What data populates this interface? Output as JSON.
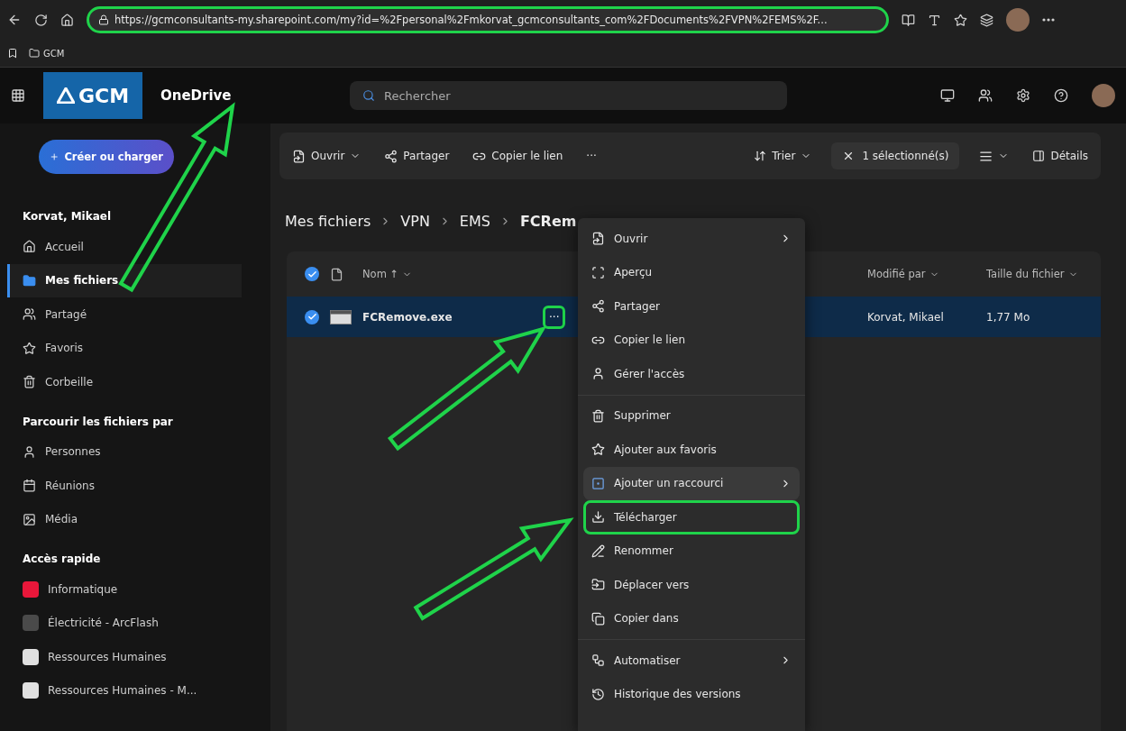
{
  "browser": {
    "url": "https://gcmconsultants-my.sharepoint.com/my?id=%2Fpersonal%2Fmkorvat_gcmconsultants_com%2FDocuments%2FVPN%2FEMS%2F...",
    "url_highlighted": true,
    "bookmarks": [
      "GCM"
    ]
  },
  "app": {
    "logo": "GCM",
    "title": "OneDrive",
    "search": {
      "placeholder": "Rechercher"
    }
  },
  "sidebar": {
    "create_button": "Créer ou charger",
    "sections": [
      {
        "heading": "Korvat, Mikael",
        "items": [
          {
            "label": "Accueil",
            "selected": false
          },
          {
            "label": "Mes fichiers",
            "selected": true
          },
          {
            "label": "Partagé",
            "selected": false
          },
          {
            "label": "Favoris",
            "selected": false
          },
          {
            "label": "Corbeille",
            "selected": false
          }
        ]
      },
      {
        "heading": "Parcourir les fichiers par",
        "items": [
          {
            "label": "Personnes",
            "selected": false
          },
          {
            "label": "Réunions",
            "selected": false
          },
          {
            "label": "Média",
            "selected": false
          }
        ]
      },
      {
        "heading": "Accès rapide",
        "items": [
          {
            "label": "Informatique",
            "color": "#e8173a",
            "selected": false
          },
          {
            "label": "Électricité - ArcFlash",
            "color": "#4a4a4a",
            "selected": false
          },
          {
            "label": "Ressources Humaines",
            "color": "#e0e0e0",
            "selected": false
          },
          {
            "label": "Ressources Humaines - M...",
            "color": "#e0e0e0",
            "selected": false
          }
        ]
      }
    ]
  },
  "toolbar": {
    "left": [
      {
        "label": "Ouvrir",
        "caret": true
      },
      {
        "label": "Partager",
        "caret": false
      },
      {
        "label": "Copier le lien",
        "caret": false
      },
      {
        "label": "···",
        "caret": false
      }
    ],
    "sort": "Trier",
    "selection": "1 sélectionné(s)",
    "details": "Détails"
  },
  "breadcrumb": [
    "Mes fichiers",
    "VPN",
    "EMS",
    "FCRem"
  ],
  "table": {
    "all_checked": true,
    "columns": [
      {
        "label": "Nom ↑",
        "sortable": true
      },
      {
        "label": "Modifié par",
        "sortable": true
      },
      {
        "label": "Taille du fichier",
        "sortable": true
      }
    ],
    "rows": [
      {
        "name": "FCRemove.exe",
        "selected": true,
        "more": "···",
        "more_highlighted": true,
        "modified_by": "Korvat, Mikael",
        "size": "1,77 Mo"
      }
    ]
  },
  "context_menu": {
    "groups": [
      [
        {
          "label": "Ouvrir",
          "submenu": true,
          "selected": false,
          "highlighted": false
        },
        {
          "label": "Aperçu",
          "submenu": false,
          "selected": false,
          "highlighted": false
        },
        {
          "label": "Partager",
          "submenu": false,
          "selected": false,
          "highlighted": false
        },
        {
          "label": "Copier le lien",
          "submenu": false,
          "selected": false,
          "highlighted": false
        },
        {
          "label": "Gérer l'accès",
          "submenu": false,
          "selected": false,
          "highlighted": false
        }
      ],
      [
        {
          "label": "Supprimer",
          "submenu": false,
          "selected": false,
          "highlighted": false
        },
        {
          "label": "Ajouter aux favoris",
          "submenu": false,
          "selected": false,
          "highlighted": false
        },
        {
          "label": "Ajouter un raccourci",
          "submenu": true,
          "selected": true,
          "highlighted": false
        },
        {
          "label": "Télécharger",
          "submenu": false,
          "selected": false,
          "highlighted": true
        },
        {
          "label": "Renommer",
          "submenu": false,
          "selected": false,
          "highlighted": false
        },
        {
          "label": "Déplacer vers",
          "submenu": false,
          "selected": false,
          "highlighted": false
        },
        {
          "label": "Copier dans",
          "submenu": false,
          "selected": false,
          "highlighted": false
        }
      ],
      [
        {
          "label": "Automatiser",
          "submenu": true,
          "selected": false,
          "highlighted": false
        },
        {
          "label": "Historique des versions",
          "submenu": false,
          "selected": false,
          "highlighted": false
        }
      ]
    ]
  },
  "annotations": [
    {
      "kind": "arrow"
    },
    {
      "kind": "arrow"
    },
    {
      "kind": "arrow"
    }
  ]
}
